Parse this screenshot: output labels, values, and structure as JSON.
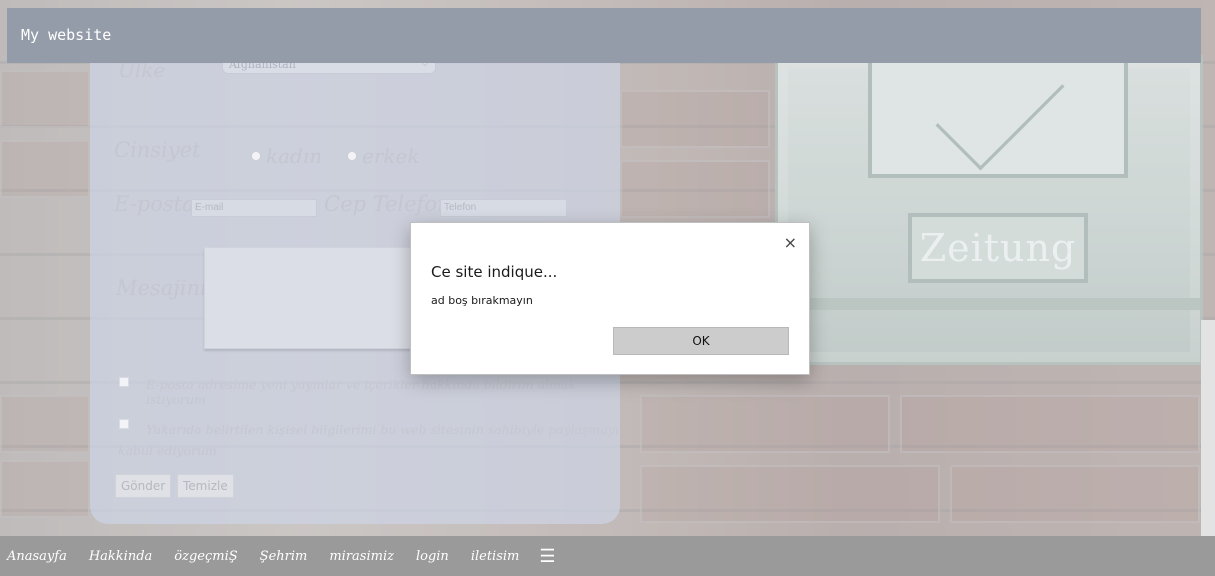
{
  "header": {
    "brand": "My website"
  },
  "form": {
    "country_label": "Ülke",
    "country_value": "Afghanistan",
    "gender_label": "Cinsiyet",
    "gender_options": [
      "kadın",
      "erkek"
    ],
    "email_label": "E-posta",
    "email_placeholder": "E-mail",
    "phone_label": "Cep Telefonu",
    "phone_placeholder": "Telefon",
    "message_label": "Mesajiniz",
    "checkbox1_text": "E-posta adresime yeni yayınlar ve içerikler hakkında bildirim almak istiyorum",
    "checkbox2_text": "Yukarıda belirtilen kişisel bilgilerimi bu web sitesinin sahibiyle paylaşmayı kabul ediyorum",
    "submit_label": "Gönder",
    "clear_label": "Temizle"
  },
  "mailbox": {
    "plate_text": "Zeitung"
  },
  "bottom_nav": {
    "links": [
      "Anasayfa",
      "Hakkinda",
      "özgeçmiŞ",
      "Şehrim",
      "mirasimiz",
      "login",
      "iletisim"
    ],
    "menu_icon": "☰"
  },
  "dialog": {
    "title": "Ce site indique...",
    "message": "ad boş bırakmayın",
    "ok_label": "OK",
    "close_glyph": "×"
  }
}
